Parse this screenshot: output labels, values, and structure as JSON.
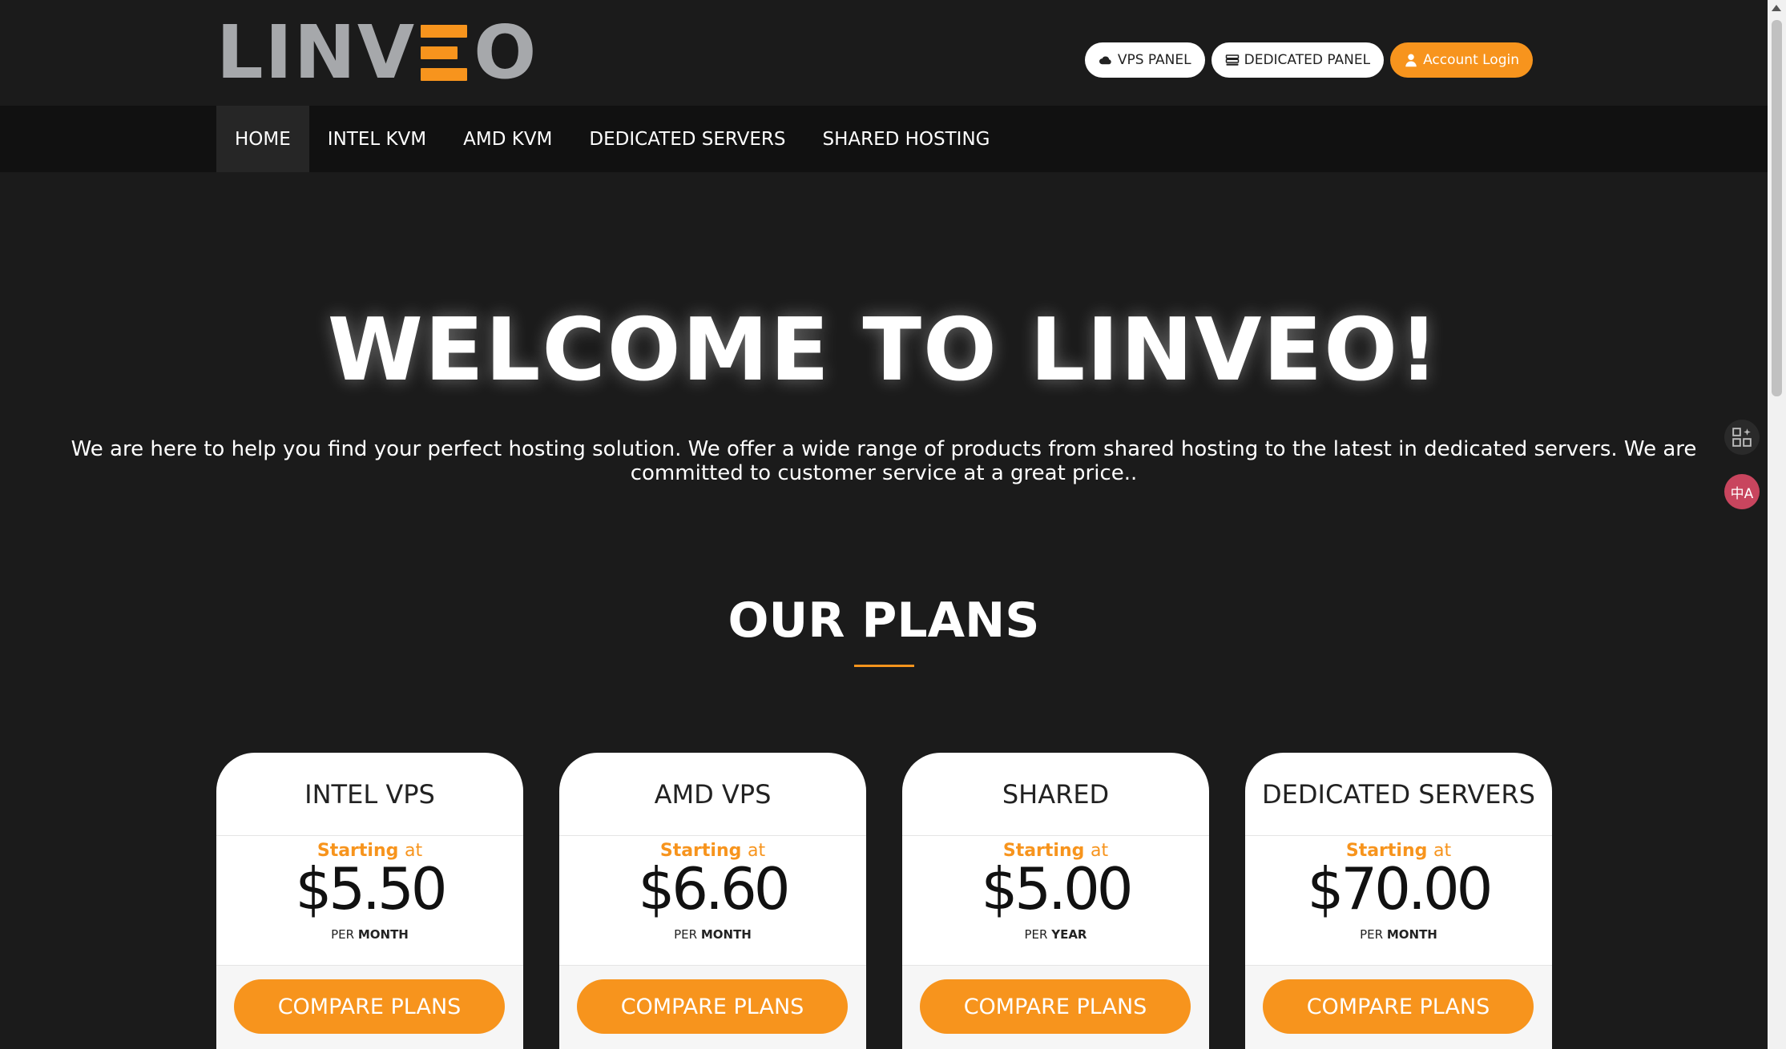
{
  "brand": {
    "logo_left": "LINV",
    "logo_right": "O",
    "colors": {
      "accent": "#f7941d",
      "logo_gray": "#a6a8ab",
      "background": "#1b1b1b",
      "nav_background": "#111111"
    }
  },
  "top_buttons": [
    {
      "label": "VPS PANEL",
      "icon": "cloud-icon"
    },
    {
      "label": "DEDICATED PANEL",
      "icon": "server-icon"
    },
    {
      "label": "Account Login",
      "icon": "user-icon"
    }
  ],
  "nav": [
    {
      "label": "HOME",
      "active": true
    },
    {
      "label": "INTEL KVM"
    },
    {
      "label": "AMD KVM"
    },
    {
      "label": "DEDICATED SERVERS"
    },
    {
      "label": "SHARED HOSTING"
    }
  ],
  "hero": {
    "title": "WELCOME TO LINVEO!",
    "subtitle": "We are here to help you find your perfect hosting solution. We offer a wide range of products from shared hosting to the latest in dedicated servers. We are committed to customer service at a great price.."
  },
  "plans_section": {
    "title": "OUR PLANS",
    "plans": [
      {
        "name": "INTEL VPS",
        "starting": "Starting",
        "at": "at",
        "price": "$5.50",
        "per": "PER",
        "period": "MONTH",
        "button": "COMPARE PLANS"
      },
      {
        "name": "AMD VPS",
        "starting": "Starting",
        "at": "at",
        "price": "$6.60",
        "per": "PER",
        "period": "MONTH",
        "button": "COMPARE PLANS"
      },
      {
        "name": "SHARED",
        "starting": "Starting",
        "at": "at",
        "price": "$5.00",
        "per": "PER",
        "period": "YEAR",
        "button": "COMPARE PLANS"
      },
      {
        "name": "DEDICATED SERVERS",
        "starting": "Starting",
        "at": "at",
        "price": "$70.00",
        "per": "PER",
        "period": "MONTH",
        "button": "COMPARE PLANS"
      }
    ]
  },
  "floating_tools": [
    {
      "icon": "grid-sparkle-icon"
    },
    {
      "icon": "translate-icon",
      "label": "中A"
    }
  ]
}
